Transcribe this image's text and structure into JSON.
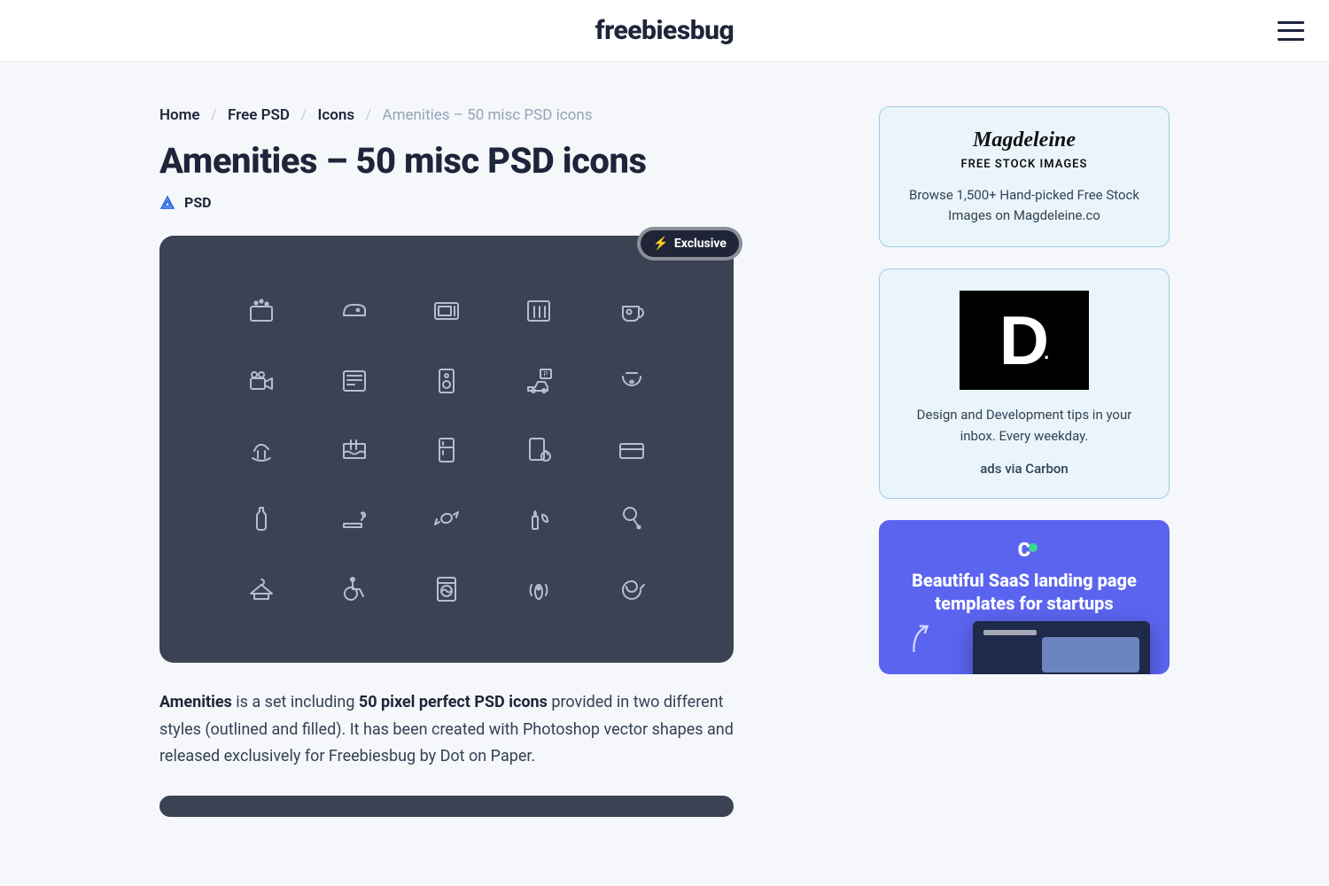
{
  "header": {
    "brand": "freebiesbug"
  },
  "breadcrumb": {
    "items": [
      "Home",
      "Free PSD",
      "Icons"
    ],
    "current": "Amenities – 50 misc PSD icons"
  },
  "page": {
    "title": "Amenities – 50 misc PSD icons",
    "tag": "PSD"
  },
  "preview": {
    "badge": "Exclusive",
    "icons": [
      "washing-basin",
      "iron",
      "microwave",
      "bottles",
      "coffee-cup",
      "video-camera",
      "newspaper",
      "speaker",
      "parking",
      "fishbowl",
      "rocking-horse",
      "pool",
      "fridge",
      "lock-screen",
      "credit-card",
      "bottle",
      "smoking",
      "candy",
      "candle-leaf",
      "tennis",
      "hanger",
      "wheelchair",
      "washer",
      "remote-sensor",
      "swirl"
    ]
  },
  "description": {
    "bold1": "Amenities",
    "text1": " is a set including ",
    "bold2": "50 pixel perfect PSD icons",
    "text2": " provided in two different styles (outlined and filled). It has been created with Photoshop vector shapes and released exclusively for Freebiesbug by Dot on Paper."
  },
  "sidebar": {
    "magdeleine": {
      "logo": "Magdeleine",
      "sub": "FREE STOCK IMAGES",
      "desc": "Browse 1,500+ Hand-picked Free Stock Images on Magdeleine.co"
    },
    "carbon": {
      "headline": "Design and Development tips in your inbox. Every weekday.",
      "via": "ads via Carbon"
    },
    "promo": {
      "title": "Beautiful SaaS landing page templates for startups"
    }
  }
}
